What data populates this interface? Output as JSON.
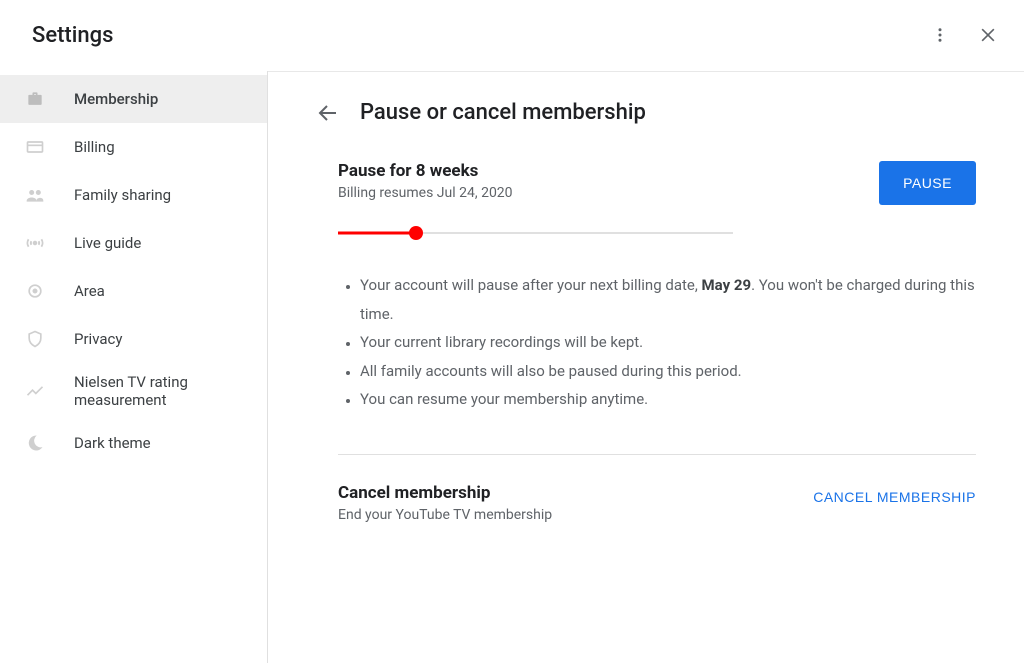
{
  "header": {
    "title": "Settings"
  },
  "sidebar": {
    "items": [
      {
        "label": "Membership",
        "icon": "suitcase-icon",
        "active": true
      },
      {
        "label": "Billing",
        "icon": "card-icon"
      },
      {
        "label": "Family sharing",
        "icon": "people-icon"
      },
      {
        "label": "Live guide",
        "icon": "live-icon"
      },
      {
        "label": "Area",
        "icon": "target-icon"
      },
      {
        "label": "Privacy",
        "icon": "shield-icon"
      },
      {
        "label": "Nielsen TV rating measurement",
        "icon": "trend-icon"
      },
      {
        "label": "Dark theme",
        "icon": "moon-icon"
      }
    ]
  },
  "page": {
    "title": "Pause or cancel membership",
    "pause": {
      "heading": "Pause for 8 weeks",
      "sub": "Billing resumes Jul 24, 2020",
      "button": "PAUSE",
      "slider_percent": 20
    },
    "bullets": {
      "b0_pre": "Your account will pause after your next billing date, ",
      "b0_strong": "May 29",
      "b0_post": ". You won't be charged during this time.",
      "b1": "Your current library recordings will be kept.",
      "b2": "All family accounts will also be paused during this period.",
      "b3": "You can resume your membership anytime."
    },
    "cancel": {
      "heading": "Cancel membership",
      "sub": "End your YouTube TV membership",
      "button": "CANCEL MEMBERSHIP"
    }
  }
}
